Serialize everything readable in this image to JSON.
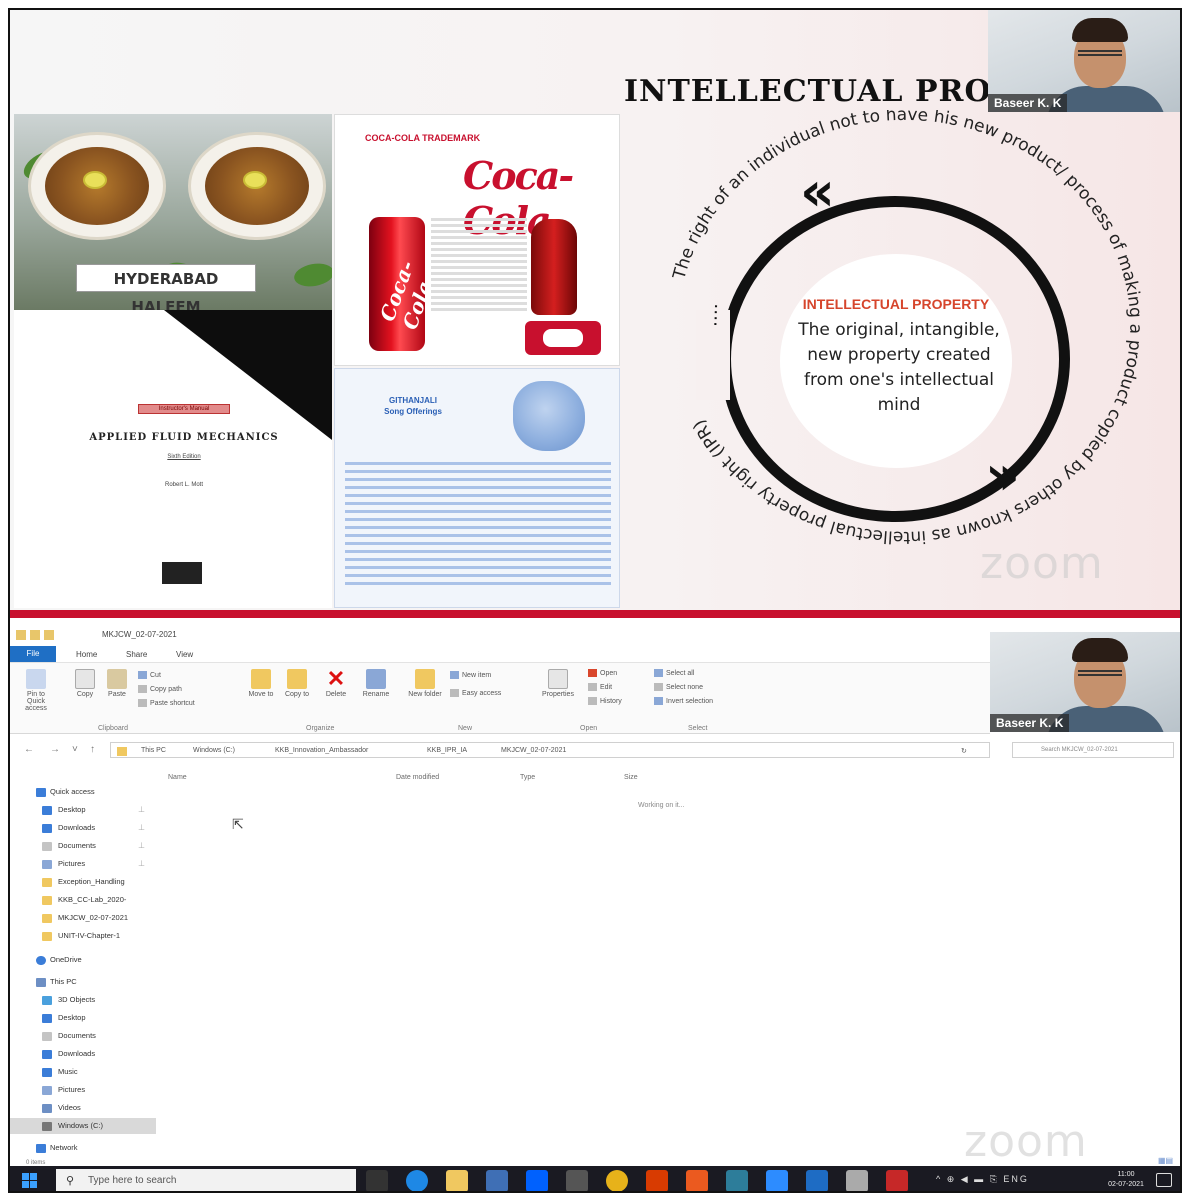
{
  "slide": {
    "title": "INTELLECTUAL PRO",
    "haleem_label": "HYDERABAD HALEEM",
    "book_badge": "Instructor's Manual",
    "book_title": "APPLIED FLUID MECHANICS",
    "book_edition": "Sixth Edition",
    "book_author": "Robert L. Mott",
    "coke_heading": "COCA-COLA TRADEMARK",
    "coke_logo": "Coca-Cola",
    "gita_heading": "GITHANJALI",
    "gita_subheading": "Song Offerings",
    "ip_heading": "INTELLECTUAL PROPERTY",
    "ip_body": "The original, intangible, new property created from one's intellectual mind",
    "arc_text": "The right of an individual not to have his new product/ process of making a product copied by others known as intellectual property right (IPR)",
    "dots": "....",
    "zoom_watermark": "zoom"
  },
  "participant": {
    "name": "Baseer K. K"
  },
  "explorer": {
    "window_title": "MKJCW_02-07-2021",
    "tabs": [
      "File",
      "Home",
      "Share",
      "View"
    ],
    "ribbon": {
      "clipboard": {
        "pin": "Pin to Quick access",
        "copy": "Copy",
        "paste": "Paste",
        "cut": "Cut",
        "copy_path": "Copy path",
        "paste_shortcut": "Paste shortcut",
        "group": "Clipboard"
      },
      "organize": {
        "move_to": "Move to",
        "copy_to": "Copy to",
        "delete": "Delete",
        "rename": "Rename",
        "group": "Organize"
      },
      "new": {
        "new_folder": "New folder",
        "new_item": "New item",
        "easy_access": "Easy access",
        "group": "New"
      },
      "open": {
        "properties": "Properties",
        "open": "Open",
        "edit": "Edit",
        "history": "History",
        "group": "Open"
      },
      "select": {
        "select_all": "Select all",
        "select_none": "Select none",
        "invert": "Invert selection",
        "group": "Select"
      }
    },
    "breadcrumb": [
      "This PC",
      "Windows (C:)",
      "KKB_Innovation_Ambassador",
      "KKB_IPR_IA",
      "MKJCW_02-07-2021"
    ],
    "search_placeholder": "Search MKJCW_02-07-2021",
    "columns": [
      "Name",
      "Date modified",
      "Type",
      "Size"
    ],
    "status": "Working on it...",
    "nav": {
      "quick_access": "Quick access",
      "quick_items": [
        "Desktop",
        "Downloads",
        "Documents",
        "Pictures",
        "Exception_Handling",
        "KKB_CC-Lab_2020-",
        "MKJCW_02-07-2021",
        "UNIT-IV-Chapter-1"
      ],
      "onedrive": "OneDrive",
      "this_pc": "This PC",
      "pc_items": [
        "3D Objects",
        "Desktop",
        "Documents",
        "Downloads",
        "Music",
        "Pictures",
        "Videos",
        "Windows (C:)"
      ],
      "network": "Network"
    },
    "items_count": "0 items"
  },
  "taskbar": {
    "search_placeholder": "Type here to search",
    "tray": "^ ⊕ ◀ ▬ ⎘ ENG",
    "time": "11:00",
    "date": "02-07-2021"
  },
  "colors": {
    "accent_red": "#c8102e",
    "file_tab_blue": "#1f6fc5",
    "ip_heading": "#d6452c"
  }
}
